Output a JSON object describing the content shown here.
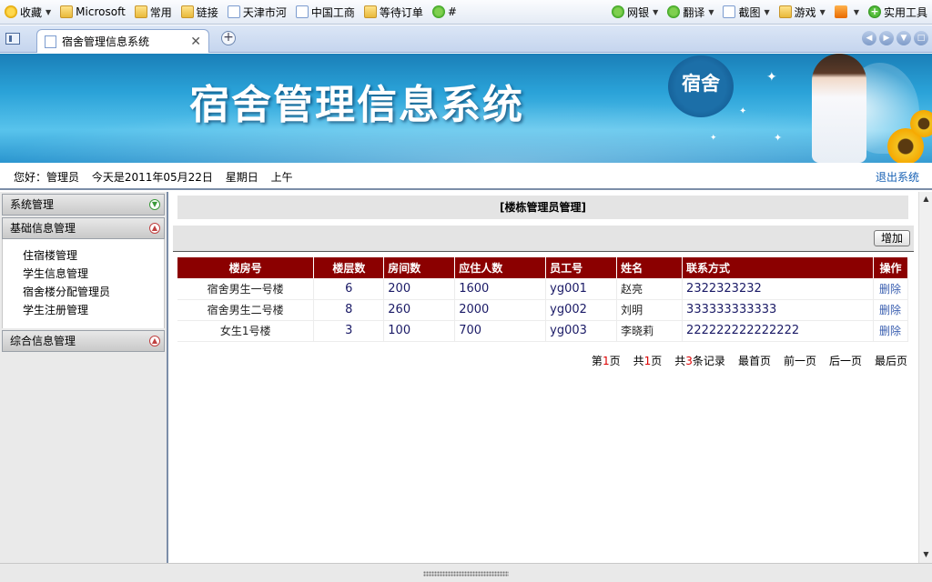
{
  "favorites": {
    "items": [
      {
        "label": "收藏",
        "icon": "star-icon",
        "dropdown": true
      },
      {
        "label": "Microsoft",
        "icon": "folder-icon"
      },
      {
        "label": "常用",
        "icon": "folder-icon"
      },
      {
        "label": "链接",
        "icon": "folder-icon"
      },
      {
        "label": "天津市河",
        "icon": "page-icon"
      },
      {
        "label": "中国工商",
        "icon": "page-icon"
      },
      {
        "label": "等待订单",
        "icon": "folder-icon"
      },
      {
        "label": "#",
        "icon": "green-leaf-icon"
      }
    ],
    "right": [
      {
        "label": "网银",
        "icon": "globe-icon"
      },
      {
        "label": "翻译",
        "icon": "translate-icon"
      },
      {
        "label": "截图",
        "icon": "screenshot-icon"
      },
      {
        "label": "游戏",
        "icon": "game-icon"
      },
      {
        "label": "",
        "icon": "app-icon"
      },
      {
        "label": "实用工具",
        "icon": "plus-icon"
      }
    ]
  },
  "tab": {
    "label": "宿舍管理信息系统",
    "close": "✕",
    "new": "+"
  },
  "banner": {
    "title": "宿舍管理信息系统",
    "seal": "宿舍"
  },
  "userbar": {
    "greeting": "您好：管理员",
    "date": "今天是2011年05月22日",
    "weekday": "星期日",
    "period": "上午",
    "logout": "退出系统"
  },
  "menu": {
    "sections": [
      {
        "label": "系统管理",
        "items": []
      },
      {
        "label": "基础信息管理",
        "items": [
          "住宿楼管理",
          "学生信息管理",
          "宿舍楼分配管理员",
          "学生注册管理"
        ]
      },
      {
        "label": "综合信息管理",
        "items": []
      }
    ]
  },
  "content": {
    "title": "[楼栋管理员管理]",
    "add_label": "增加",
    "columns": [
      "楼房号",
      "楼层数",
      "房间数",
      "应住人数",
      "员工号",
      "姓名",
      "联系方式",
      "操作"
    ],
    "rows": [
      [
        "宿舍男生一号楼",
        "6",
        "200",
        "1600",
        "yg001",
        "赵亮",
        "2322323232",
        "删除"
      ],
      [
        "宿舍男生二号楼",
        "8",
        "260",
        "2000",
        "yg002",
        "刘明",
        "333333333333",
        "删除"
      ],
      [
        "女生1号楼",
        "3",
        "100",
        "700",
        "yg003",
        "李晓莉",
        "222222222222222",
        "删除"
      ]
    ],
    "pager": {
      "page_prefix": "第",
      "page": "1",
      "page_suffix": "页",
      "total_prefix": "共",
      "total_pages": "1",
      "total_suffix": "页",
      "records_prefix": "共",
      "records": "3",
      "records_suffix": "条记录",
      "first": "最首页",
      "prev": "前一页",
      "next": "后一页",
      "last": "最后页"
    }
  }
}
